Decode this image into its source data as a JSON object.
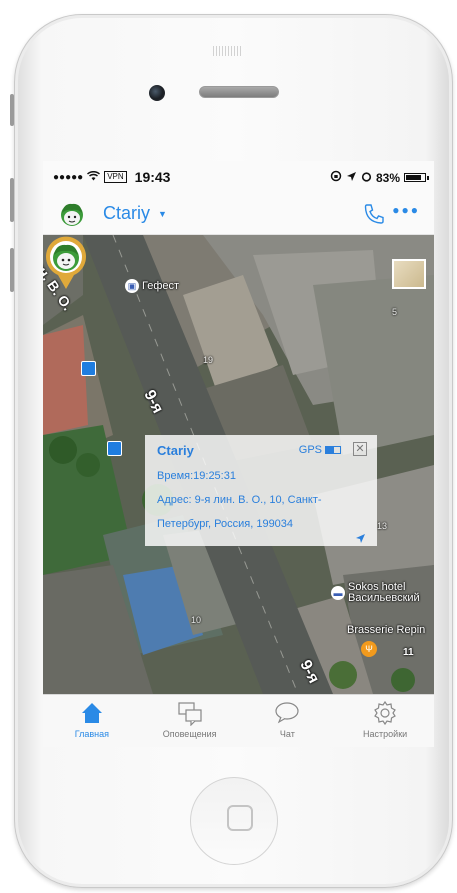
{
  "status_bar": {
    "signal": "●●●●●",
    "vpn": "VPN",
    "time": "19:43",
    "battery_percent": "83%",
    "battery_level": 0.83
  },
  "header": {
    "user_name": "Ctariy",
    "accent_color": "#2a8ae6"
  },
  "map": {
    "street_top_left": "ин. В. О.",
    "street_middle": "9-я",
    "street_bottom": "9-я",
    "pois": {
      "gefest": "Гефест",
      "sokos_line1": "Sokos hotel",
      "sokos_line2": "Васильевский",
      "brasserie": "Brasserie Repin"
    },
    "building_numbers": [
      "18",
      "11",
      "10",
      "19",
      "13",
      "5",
      "4",
      "11"
    ]
  },
  "popup": {
    "title": "Ctariy",
    "gps_label": "GPS",
    "gps_battery_level": 0.6,
    "close": "✕",
    "time_line": "Время:19:25:31",
    "address_line1": "Адрес: 9-я лин. В. О., 10, Санкт-",
    "address_line2": "Петербург, Россия, 199034"
  },
  "tabs": [
    {
      "label": "Главная",
      "icon": "home-icon",
      "active": true
    },
    {
      "label": "Оповещения",
      "icon": "notifications-icon",
      "active": false
    },
    {
      "label": "Чат",
      "icon": "chat-icon",
      "active": false
    },
    {
      "label": "Настройки",
      "icon": "settings-icon",
      "active": false
    }
  ]
}
